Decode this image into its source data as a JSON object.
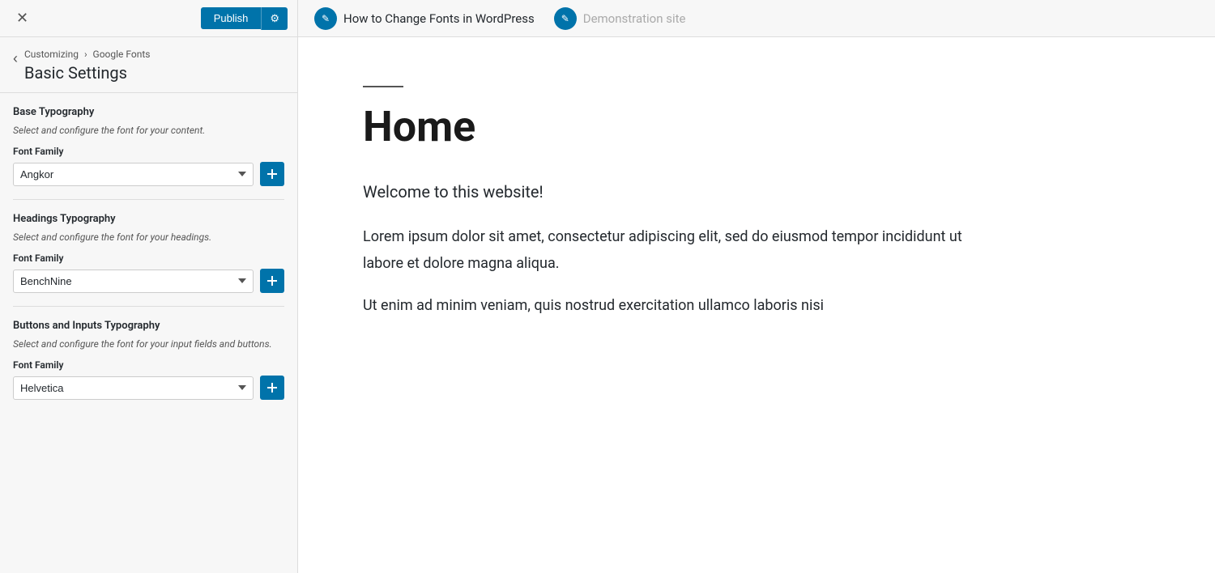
{
  "topbar": {
    "publish_label": "Publish",
    "gear_icon": "⚙",
    "close_icon": "✕"
  },
  "breadcrumb": {
    "customizing": "Customizing",
    "separator": "›",
    "parent": "Google Fonts",
    "back_icon": "‹",
    "page_title": "Basic Settings"
  },
  "sections": [
    {
      "id": "base_typography",
      "title": "Base Typography",
      "desc": "Select and configure the font for your content.",
      "field_label": "Font Family",
      "font_value": "Angkor",
      "expand_icon": "⊞"
    },
    {
      "id": "headings_typography",
      "title": "Headings Typography",
      "desc": "Select and configure the font for your headings.",
      "field_label": "Font Family",
      "font_value": "BenchNine",
      "expand_icon": "⊞"
    },
    {
      "id": "buttons_inputs_typography",
      "title": "Buttons and Inputs Typography",
      "desc": "Select and configure the font for your input fields and buttons.",
      "field_label": "Font Family",
      "font_value": "Helvetica",
      "expand_icon": "⊞"
    }
  ],
  "preview": {
    "nav_link1_text": "How to Change Fonts in WordPress",
    "nav_link2_text": "Demonstration site",
    "edit_icon": "✎",
    "heading": "Home",
    "subtitle": "Welcome to this website!",
    "body1": "Lorem ipsum dolor sit amet, consectetur adipiscing elit, sed do eiusmod tempor incididunt ut labore et dolore magna aliqua.",
    "body2": "Ut enim ad minim veniam, quis nostrud exercitation ullamco laboris nisi"
  }
}
